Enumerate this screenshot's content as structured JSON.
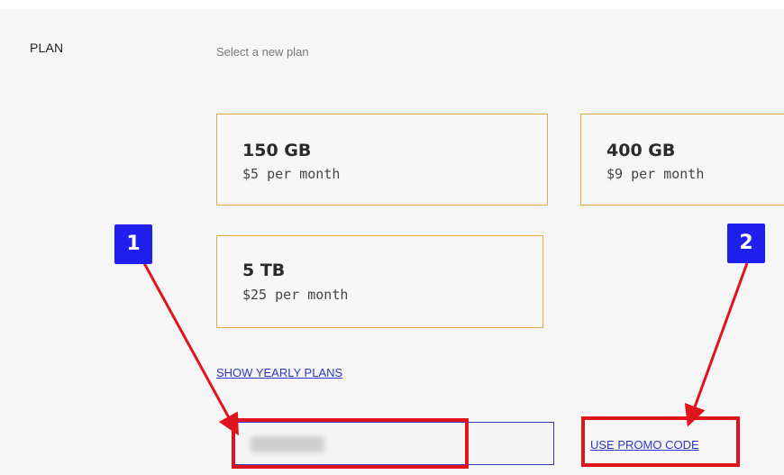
{
  "plan_section": {
    "label": "PLAN",
    "hint": "Select a new plan"
  },
  "plans": [
    {
      "size": "150 GB",
      "price": "$5 per month"
    },
    {
      "size": "400 GB",
      "price": "$9 per month"
    },
    {
      "size": "5 TB",
      "price": "$25 per month"
    }
  ],
  "links": {
    "yearly": "SHOW YEARLY PLANS",
    "promo": "USE PROMO CODE"
  },
  "annotations": {
    "badge_1": "1",
    "badge_2": "2",
    "highlight_color": "#e0141c",
    "badge_color": "#1f1ff0"
  },
  "colors": {
    "card_border": "#e0a94a",
    "link": "#2a38c8"
  }
}
